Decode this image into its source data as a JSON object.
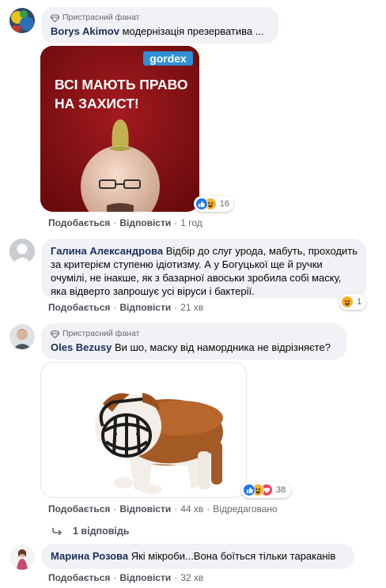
{
  "comments": [
    {
      "author": "Borys Akimov",
      "badge": "Пристрасний фанат",
      "text": "модернізація презерватива ...",
      "image": {
        "brand": "gordex",
        "headline_line1": "ВСІ МАЮТЬ ПРАВО",
        "headline_line2": "НА ЗАХИСТ!"
      },
      "reactions": {
        "count": "16",
        "icons": [
          "like-icon",
          "haha-icon"
        ]
      },
      "actions": {
        "like": "Подобається",
        "reply": "Відповісти",
        "time": "1 год"
      }
    },
    {
      "author": "Галина Александрова",
      "text": "Відбір до слуг урода, мабуть, проходить за критерієм ступеню ідіотизму. А у Богуцької ще й ручки очумілі, не інакше, як з базарної авоськи зробила собі маску, яка відверто запрошує усі віруси і бактерії.",
      "reactions": {
        "count": "1",
        "icons": [
          "haha-icon"
        ]
      },
      "actions": {
        "like": "Подобається",
        "reply": "Відповісти",
        "time": "21 хв"
      }
    },
    {
      "author": "Oles Bezusy",
      "badge": "Пристрасний фанат",
      "text": "Ви шо, маску від намордника не відрізняєте?",
      "reactions": {
        "count": "38",
        "icons": [
          "like-icon",
          "haha-icon",
          "love-icon"
        ]
      },
      "actions": {
        "like": "Подобається",
        "reply": "Відповісти",
        "time": "44 хв",
        "edited": "Відредаговано"
      },
      "replies_link": "1 відповідь"
    },
    {
      "author": "Марина Розова",
      "text": "Які мікроби...Вона боїться тільки тараканів",
      "actions": {
        "like": "Подобається",
        "reply": "Відповісти",
        "time": "32 хв"
      }
    }
  ],
  "colors": {
    "link": "#1a2e5a",
    "meta": "#65676b",
    "bubble": "#f0f2f5",
    "like": "#1877f2",
    "haha": "#f7b125",
    "love": "#f33e58"
  }
}
